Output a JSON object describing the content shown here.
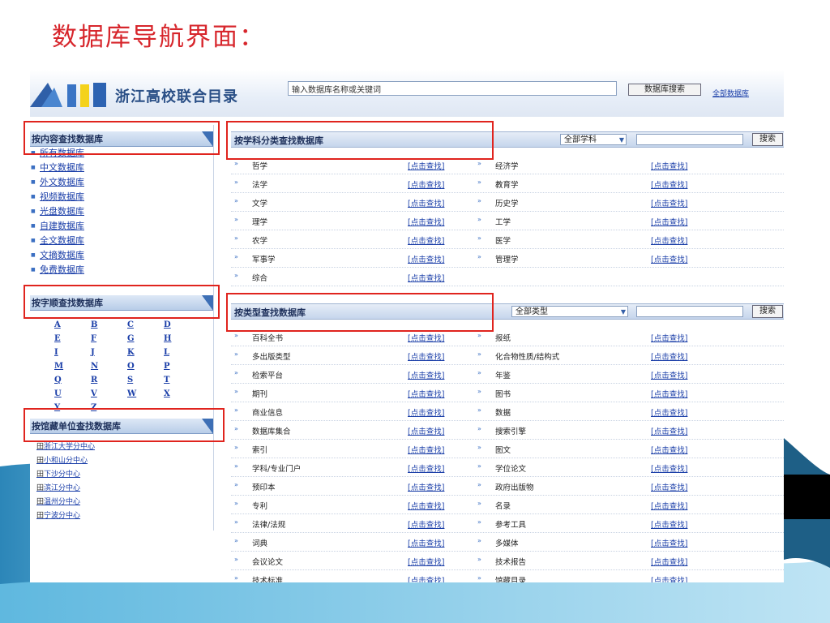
{
  "slide": {
    "title": "数据库导航界面："
  },
  "header": {
    "brand": "浙江高校联合目录",
    "search_value": "输入数据库名称或关键词",
    "db_search_button": "数据库搜索",
    "all_db_link": "全部数据库"
  },
  "left": {
    "content_head": "按内容查找数据库",
    "content_items": [
      "所有数据库",
      "中文数据库",
      "外文数据库",
      "视频数据库",
      "光盘数据库",
      "自建数据库",
      "全文数据库",
      "文摘数据库",
      "免费数据库"
    ],
    "alpha_head": "按字顺查找数据库",
    "alpha_rows": [
      [
        "A",
        "B",
        "C",
        "D"
      ],
      [
        "E",
        "F",
        "G",
        "H"
      ],
      [
        "I",
        "J",
        "K",
        "L"
      ],
      [
        "M",
        "N",
        "O",
        "P"
      ],
      [
        "Q",
        "R",
        "S",
        "T"
      ],
      [
        "U",
        "V",
        "W",
        "X"
      ],
      [
        "Y",
        "Z"
      ]
    ],
    "branch_head": "按馆藏单位查找数据库",
    "branch_items": [
      "浙江大学分中心",
      "小和山分中心",
      "下沙分中心",
      "滨江分中心",
      "温州分中心",
      "宁波分中心"
    ],
    "branch_prefix": "田"
  },
  "subject": {
    "title": "按学科分类查找数据库",
    "select_value": "全部学科",
    "search_button": "搜索",
    "find_label": "[点击查找]",
    "rows": [
      [
        "哲学",
        "经济学"
      ],
      [
        "法学",
        "教育学"
      ],
      [
        "文学",
        "历史学"
      ],
      [
        "理学",
        "工学"
      ],
      [
        "农学",
        "医学"
      ],
      [
        "军事学",
        "管理学"
      ],
      [
        "综合",
        ""
      ]
    ]
  },
  "type": {
    "title": "按类型查找数据库",
    "select_value": "全部类型",
    "search_button": "搜索",
    "find_label": "[点击查找]",
    "rows": [
      [
        "百科全书",
        "报纸"
      ],
      [
        "多出版类型",
        "化合物性质/结构式"
      ],
      [
        "检索平台",
        "年鉴"
      ],
      [
        "期刊",
        "图书"
      ],
      [
        "商业信息",
        "数据"
      ],
      [
        "数据库集合",
        "搜索引擎"
      ],
      [
        "索引",
        "图文"
      ],
      [
        "学科/专业门户",
        "学位论文"
      ],
      [
        "预印本",
        "政府出版物"
      ],
      [
        "专利",
        "名录"
      ],
      [
        "法律/法规",
        "参考工具"
      ],
      [
        "词典",
        "多媒体"
      ],
      [
        "会议论文",
        "技术报告"
      ],
      [
        "技术标准",
        "馆藏目录"
      ]
    ]
  },
  "arrow_glyph": "»",
  "colors": {
    "title_red": "#d7262c",
    "link_blue": "#1a3ea8",
    "highlight_red": "#e0241e",
    "header_navy": "#1d2f5a"
  }
}
